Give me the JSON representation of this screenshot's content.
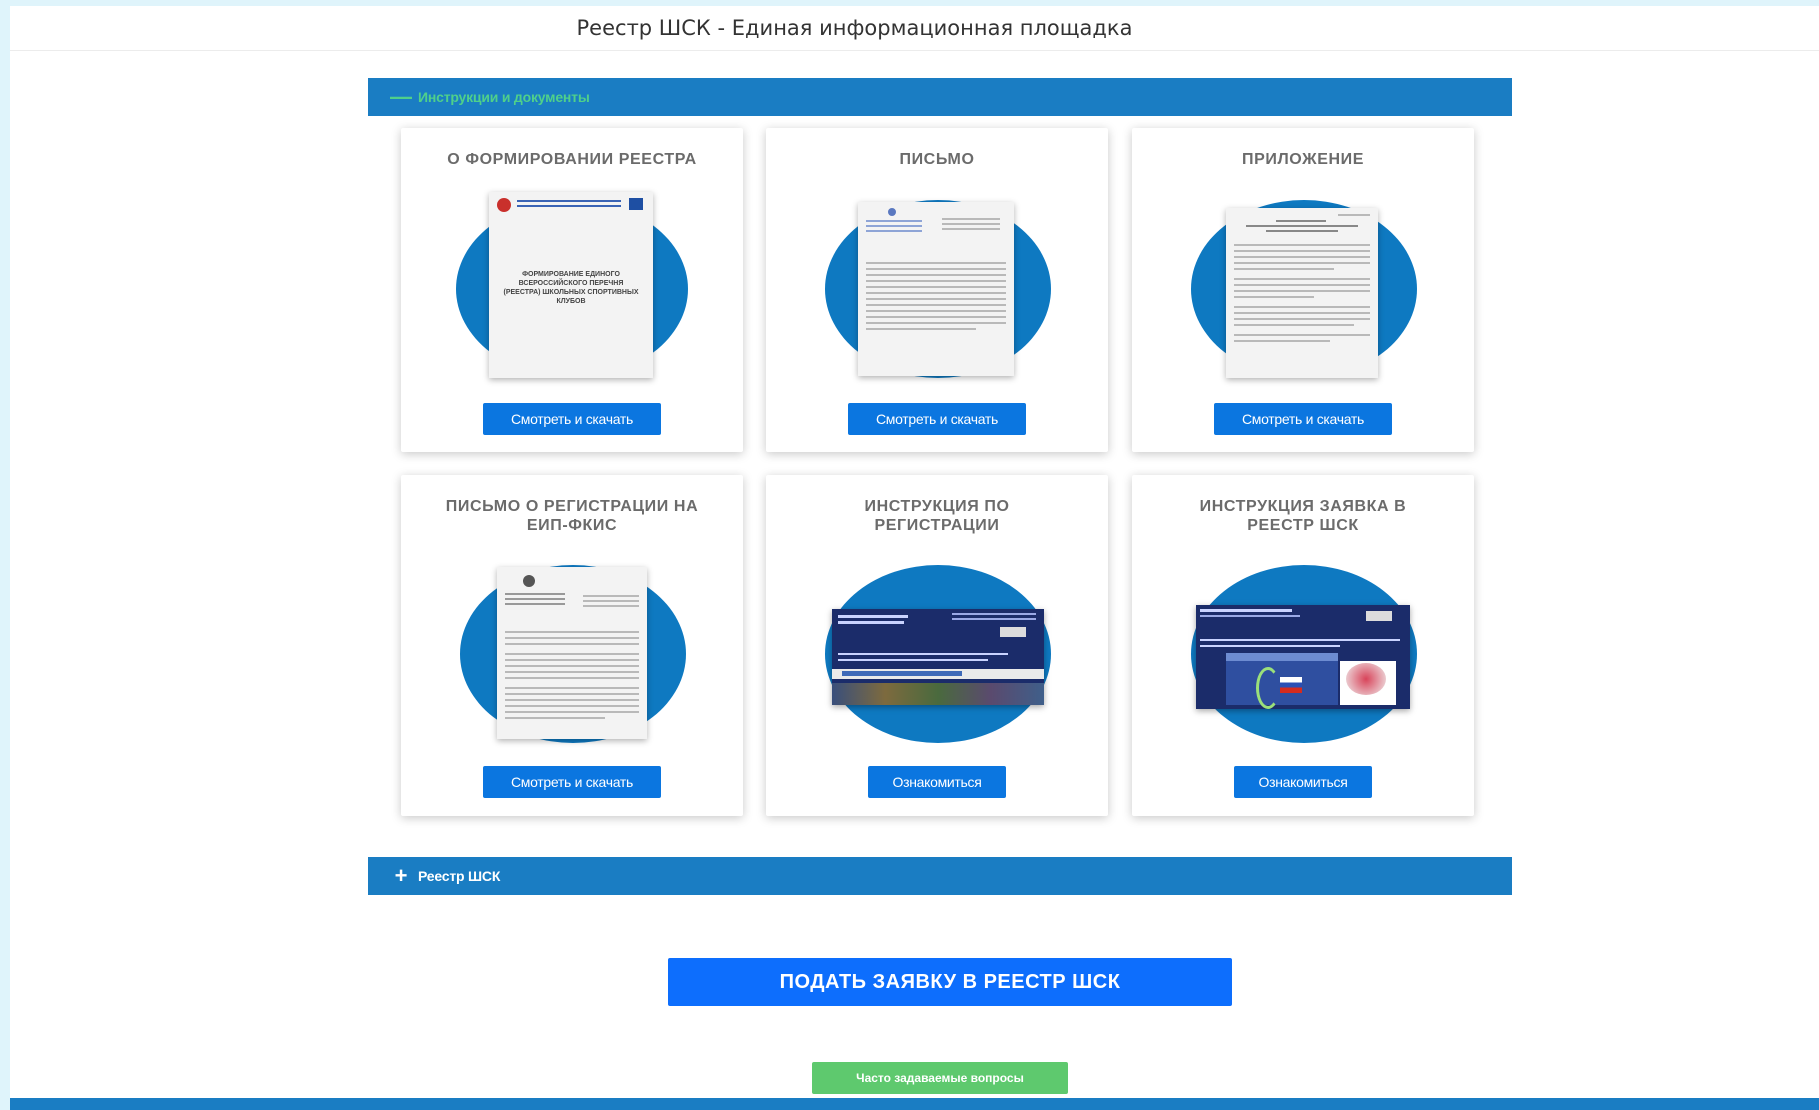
{
  "header": {
    "title": "Реестр ШСК - Единая информационная площадка"
  },
  "accordions": {
    "docs": {
      "sign": "—",
      "label": "Инструкции и документы"
    },
    "registry": {
      "sign": "+",
      "label": "Реестр ШСК"
    }
  },
  "cards": [
    {
      "title": "О ФОРМИРОВАНИИ РЕЕСТРА",
      "button": "Смотреть и скачать",
      "doc_text": "ФОРМИРОВАНИЕ ЕДИНОГО ВСЕРОССИЙСКОГО ПЕРЕЧНЯ (РЕЕСТРА) ШКОЛЬНЫХ СПОРТИВНЫХ КЛУБОВ"
    },
    {
      "title": "ПИСЬМО",
      "button": "Смотреть и скачать"
    },
    {
      "title": "ПРИЛОЖЕНИЕ",
      "button": "Смотреть и скачать"
    },
    {
      "title": "ПИСЬМО О РЕГИСТРАЦИИ НА ЕИП-ФКИС",
      "button": "Смотреть и скачать"
    },
    {
      "title": "ИНСТРУКЦИЯ ПО РЕГИСТРАЦИИ",
      "button": "Ознакомиться"
    },
    {
      "title": "ИНСТРУКЦИЯ ЗАЯВКА В РЕЕСТР ШСК",
      "button": "Ознакомиться"
    }
  ],
  "actions": {
    "submit": "ПОДАТЬ ЗАЯВКУ В РЕЕСТР ШСК",
    "faq": "Часто задаваемые вопросы"
  },
  "colors": {
    "accent_blue": "#1a7dc3",
    "button_blue": "#0b76e0",
    "faq_green": "#5ec96e",
    "accordion_label_green": "#4fd08a"
  }
}
